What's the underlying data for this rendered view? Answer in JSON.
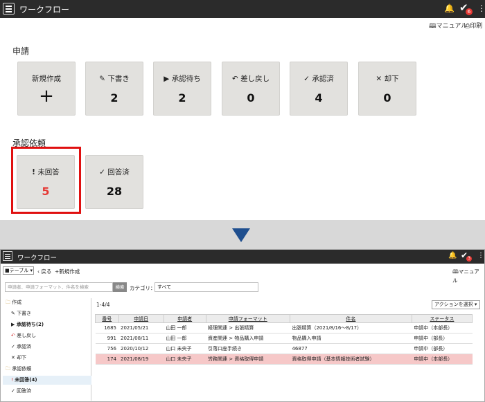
{
  "top_app": {
    "title": "ワークフロー",
    "badge": "6",
    "manual": "マニュアル",
    "print": "印刷"
  },
  "requests": {
    "title": "申請",
    "tiles": [
      {
        "label": "新規作成",
        "value": "+",
        "icon": "none"
      },
      {
        "label": "下書き",
        "value": "2",
        "icon": "pencil-icon"
      },
      {
        "label": "承認待ち",
        "value": "2",
        "icon": "play-icon"
      },
      {
        "label": "差し戻し",
        "value": "0",
        "icon": "return-icon"
      },
      {
        "label": "承認済",
        "value": "4",
        "icon": "check-icon"
      },
      {
        "label": "却下",
        "value": "0",
        "icon": "x-icon"
      }
    ]
  },
  "approvals": {
    "title": "承認依頼",
    "tiles": [
      {
        "label": "未回答",
        "value": "5",
        "icon": "exclamation-icon"
      },
      {
        "label": "回答済",
        "value": "28",
        "icon": "check-icon"
      }
    ]
  },
  "bottom_app": {
    "title": "ワークフロー",
    "badge": "3",
    "manual": "マニュアル",
    "view_select": "テーブル",
    "back": "戻る",
    "new": "新規作成",
    "search_placeholder": "申請者、申請フォーマット、件名を検索",
    "search_button": "検索",
    "category_label": "カテゴリ：",
    "category_value": "すべて",
    "count": "1-4/4",
    "action_select": "アクションを選択",
    "sidebar": [
      {
        "label": "作成",
        "icon": "folder-icon",
        "indent": false,
        "bold": false,
        "selected": false
      },
      {
        "label": "下書き",
        "icon": "pencil-icon",
        "indent": true,
        "bold": false,
        "selected": false
      },
      {
        "label": "承認待ち(2)",
        "icon": "play-icon",
        "indent": true,
        "bold": true,
        "selected": false
      },
      {
        "label": "差し戻し",
        "icon": "return-icon",
        "indent": true,
        "bold": false,
        "selected": false
      },
      {
        "label": "承認済",
        "icon": "check-icon",
        "indent": true,
        "bold": false,
        "selected": false
      },
      {
        "label": "却下",
        "icon": "x-icon",
        "indent": true,
        "bold": false,
        "selected": false
      },
      {
        "label": "承認依頼",
        "icon": "folder-icon",
        "indent": false,
        "bold": false,
        "selected": false
      },
      {
        "label": "未回答(4)",
        "icon": "exclamation-icon",
        "indent": true,
        "bold": true,
        "selected": true
      },
      {
        "label": "回答済",
        "icon": "check-icon",
        "indent": true,
        "bold": false,
        "selected": false
      }
    ],
    "table": {
      "headers": [
        "番号",
        "申請日",
        "申請者",
        "申請フォーマット",
        "件名",
        "ステータス"
      ],
      "rows": [
        [
          "1685",
          "2021/05/21",
          "山田 一郎",
          "経理関連 > 出張精算",
          "出張精算（2021/8/16～8/17）",
          "申請中（本部長）"
        ],
        [
          "991",
          "2021/08/11",
          "山田 一郎",
          "資産関連 > 物品購入申請",
          "物品購入申請",
          "申請中（部長）"
        ],
        [
          "756",
          "2020/10/12",
          "山口 未央子",
          "引落口座手続き",
          "46877",
          "申請中（部長）"
        ],
        [
          "174",
          "2021/08/19",
          "山口 未央子",
          "労務関連 > 資格取得申請",
          "資格取得申請（基本情報技術者試験）",
          "申請中（本部長）"
        ]
      ],
      "highlight_row": 3
    }
  },
  "colors": {
    "accent_red": "#e01010",
    "arrow_blue": "#1f4f8f",
    "highlight_row": "#f6c8c8"
  }
}
